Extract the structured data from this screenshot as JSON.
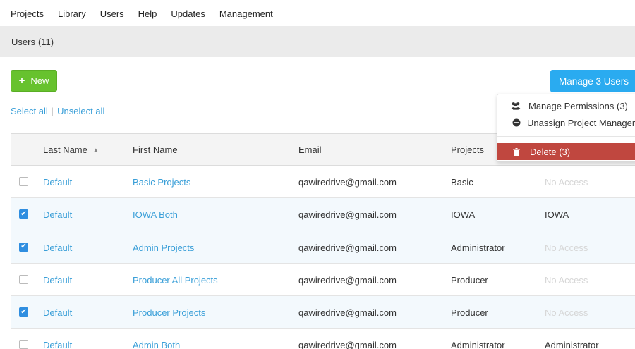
{
  "nav": {
    "items": [
      "Projects",
      "Library",
      "Users",
      "Help",
      "Updates",
      "Management"
    ]
  },
  "subheader": {
    "title": "Users",
    "count": "(11)"
  },
  "actions": {
    "new_label": "New",
    "manage_label": "Manage 3 Users"
  },
  "select": {
    "select_all": "Select all",
    "unselect_all": "Unselect all"
  },
  "table": {
    "headers": {
      "last_name": "Last Name",
      "first_name": "First Name",
      "email": "Email",
      "projects": "Projects"
    },
    "rows": [
      {
        "checked": false,
        "last": "Default",
        "first": "Basic Projects",
        "email": "qawiredrive@gmail.com",
        "projects": "Basic",
        "extra": "No Access",
        "extra_muted": true
      },
      {
        "checked": true,
        "last": "Default",
        "first": "IOWA Both",
        "email": "qawiredrive@gmail.com",
        "projects": "IOWA",
        "extra": "IOWA",
        "extra_muted": false
      },
      {
        "checked": true,
        "last": "Default",
        "first": "Admin Projects",
        "email": "qawiredrive@gmail.com",
        "projects": "Administrator",
        "extra": "No Access",
        "extra_muted": true
      },
      {
        "checked": false,
        "last": "Default",
        "first": "Producer All Projects",
        "email": "qawiredrive@gmail.com",
        "projects": "Producer",
        "extra": "No Access",
        "extra_muted": true
      },
      {
        "checked": true,
        "last": "Default",
        "first": "Producer Projects",
        "email": "qawiredrive@gmail.com",
        "projects": "Producer",
        "extra": "No Access",
        "extra_muted": true
      },
      {
        "checked": false,
        "last": "Default",
        "first": "Admin Both",
        "email": "qawiredrive@gmail.com",
        "projects": "Administrator",
        "extra": "Administrator",
        "extra_muted": false
      }
    ]
  },
  "dropdown": {
    "items": [
      {
        "label": "Manage Permissions (3)",
        "icon": "users-icon"
      },
      {
        "label": "Unassign Project Manager",
        "icon": "minus-circle-icon"
      },
      {
        "label": "Delete (3)",
        "icon": "trash-icon"
      }
    ]
  },
  "colors": {
    "accent": "#2aabf0",
    "new_button": "#67c22e",
    "danger": "#c0473f",
    "link": "#3a9fd8"
  }
}
